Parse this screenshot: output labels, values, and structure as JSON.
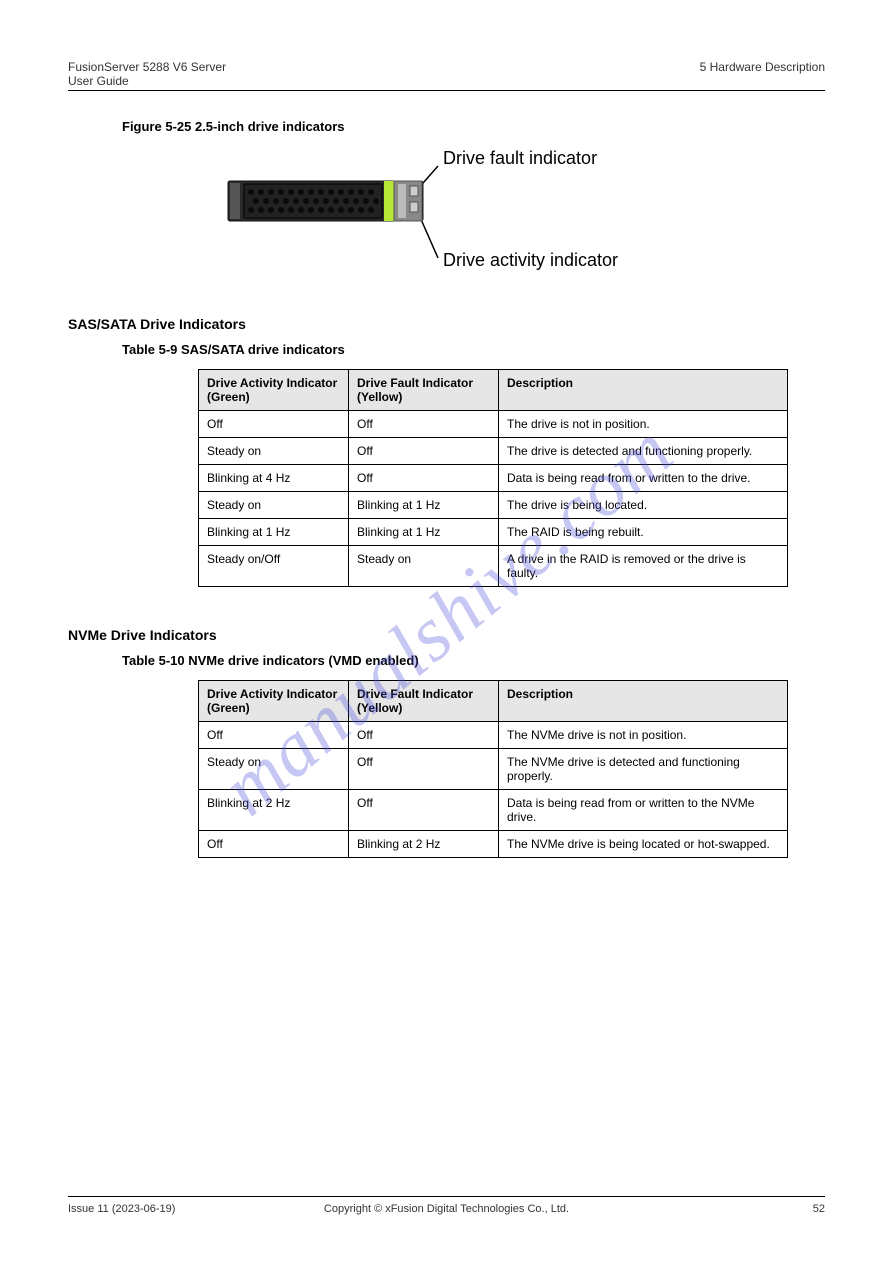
{
  "header": {
    "left_line1": "FusionServer 5288 V6 Server",
    "left_line2": "User Guide",
    "right": "5 Hardware Description"
  },
  "figure": {
    "caption": "Figure 5-25 2.5-inch drive indicators",
    "label_fault": "Drive fault indicator",
    "label_activity": "Drive activity indicator"
  },
  "sas": {
    "heading": "SAS/SATA Drive Indicators",
    "table_caption": "Table 5-9 SAS/SATA drive indicators",
    "columns": [
      "Drive Activity Indicator (Green)",
      "Drive Fault Indicator (Yellow)",
      "Description"
    ],
    "rows": [
      [
        "Off",
        "Off",
        "The drive is not in position."
      ],
      [
        "Steady on",
        "Off",
        "The drive is detected and functioning properly."
      ],
      [
        "Blinking at 4 Hz",
        "Off",
        "Data is being read from or written to the drive."
      ],
      [
        "Steady on",
        "Blinking at 1 Hz",
        "The drive is being located."
      ],
      [
        "Blinking at 1 Hz",
        "Blinking at 1 Hz",
        "The RAID is being rebuilt."
      ],
      [
        "Steady on/Off",
        "Steady on",
        "A drive in the RAID is removed or the drive is faulty."
      ]
    ]
  },
  "nvme": {
    "heading": "NVMe Drive Indicators",
    "table_caption": "Table 5-10 NVMe drive indicators (VMD enabled)",
    "columns": [
      "Drive Activity Indicator (Green)",
      "Drive Fault Indicator (Yellow)",
      "Description"
    ],
    "rows": [
      [
        "Off",
        "Off",
        "The NVMe drive is not in position."
      ],
      [
        "Steady on",
        "Off",
        "The NVMe drive is detected and functioning properly."
      ],
      [
        "Blinking at 2 Hz",
        "Off",
        "Data is being read from or written to the NVMe drive."
      ],
      [
        "Off",
        "Blinking at 2 Hz",
        "The NVMe drive is being located or hot-swapped."
      ]
    ]
  },
  "footer": {
    "left": "Issue 11 (2023-06-19)",
    "center": "Copyright © xFusion Digital Technologies Co., Ltd.",
    "right": "52"
  },
  "watermark": "manualshive.com"
}
